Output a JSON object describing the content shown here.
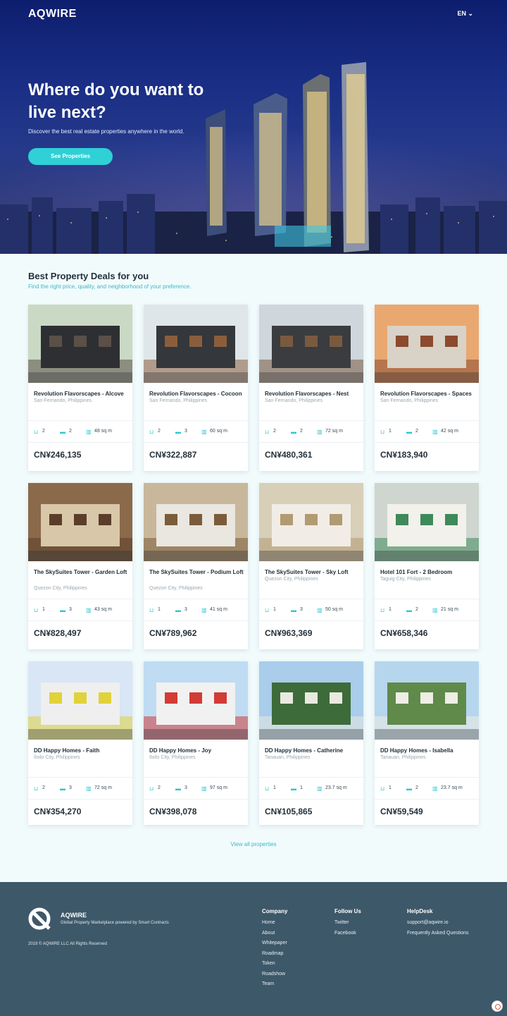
{
  "header": {
    "logo": "AQWIRE",
    "lang": "EN ⌄"
  },
  "hero": {
    "title": "Where do you want to live next?",
    "subtitle": "Discover the best real estate properties anywhere in the world.",
    "cta": "See Properties"
  },
  "section": {
    "title": "Best Property Deals for you",
    "subtitle": "Find the right price, quality, and neighborhood of your preference."
  },
  "properties": [
    {
      "name": "Revolution Flavorscapes - Alcove",
      "location": "San Fernando, Philippines",
      "baths": "2",
      "beds": "2",
      "area": "48 sq m",
      "price": "CN¥246,135",
      "theme": "townhouse-dark"
    },
    {
      "name": "Revolution Flavorscapes - Cocoon",
      "location": "San Fernando, Philippines",
      "baths": "2",
      "beds": "3",
      "area": "60 sq m",
      "price": "CN¥322,887",
      "theme": "house-dark"
    },
    {
      "name": "Revolution Flavorscapes - Nest",
      "location": "San Fernando, Philippines",
      "baths": "2",
      "beds": "2",
      "area": "72 sq m",
      "price": "CN¥480,361",
      "theme": "house-dark2"
    },
    {
      "name": "Revolution Flavorscapes - Spaces",
      "location": "San Fernando, Philippines",
      "baths": "1",
      "beds": "2",
      "area": "42 sq m",
      "price": "CN¥183,940",
      "theme": "rowhouse"
    },
    {
      "name": "The SkySuites Tower - Garden Loft",
      "location": "Quezon City, Philippines",
      "baths": "1",
      "beds": "3",
      "area": "43 sq m",
      "price": "CN¥828,497",
      "theme": "interior-warm"
    },
    {
      "name": "The SkySuites Tower - Podium Loft",
      "location": "Quezon City, Philippines",
      "baths": "1",
      "beds": "3",
      "area": "41 sq m",
      "price": "CN¥789,962",
      "theme": "interior-wood"
    },
    {
      "name": "The SkySuites Tower - Sky Loft",
      "location": "Quezon City, Philippines",
      "baths": "1",
      "beds": "3",
      "area": "50 sq m",
      "price": "CN¥963,369",
      "theme": "interior-light"
    },
    {
      "name": "Hotel 101 Fort - 2 Bedroom",
      "location": "Taguig City, Philippines",
      "baths": "1",
      "beds": "2",
      "area": "21 sq m",
      "price": "CN¥658,346",
      "theme": "interior-hotel"
    },
    {
      "name": "DD Happy Homes - Faith",
      "location": "Iloilo City, Philippines",
      "baths": "2",
      "beds": "3",
      "area": "72 sq m",
      "price": "CN¥354,270",
      "theme": "yellow-house"
    },
    {
      "name": "DD Happy Homes - Joy",
      "location": "Iloilo City, Philippines",
      "baths": "2",
      "beds": "3",
      "area": "97 sq m",
      "price": "CN¥398,078",
      "theme": "red-house"
    },
    {
      "name": "DD Happy Homes - Catherine",
      "location": "Tanauan, Philippines",
      "baths": "1",
      "beds": "1",
      "area": "23.7 sq m",
      "price": "CN¥105,865",
      "theme": "green-house"
    },
    {
      "name": "DD Happy Homes - Isabella",
      "location": "Tanauan, Philippines",
      "baths": "1",
      "beds": "2",
      "area": "23.7 sq m",
      "price": "CN¥59,549",
      "theme": "green-row"
    }
  ],
  "view_all": "View all properties",
  "footer": {
    "brand": "AQWIRE",
    "tagline": "Global Property Marketplace powered by Smart Contracts",
    "copyright": "2019 © AQWIRE LLC All Rights Reserved",
    "columns": [
      {
        "title": "Company",
        "links": [
          "Home",
          "About",
          "Whitepaper",
          "Roadmap",
          "Token",
          "Roadshow",
          "Team"
        ]
      },
      {
        "title": "Follow Us",
        "links": [
          "Twitter",
          "Facebook"
        ]
      },
      {
        "title": "HelpDesk",
        "links": [
          "support@aqwire.io",
          "Frequently Asked Questions"
        ]
      }
    ]
  },
  "colors": {
    "accent": "#2fd0d6",
    "footer": "#3d5869",
    "hero": "#1a2f86"
  }
}
